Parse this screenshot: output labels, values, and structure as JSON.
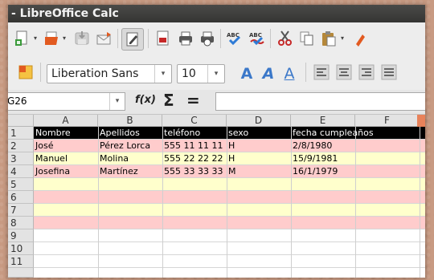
{
  "window": {
    "title": "- LibreOffice Calc"
  },
  "toolbar_standard": {
    "icons": [
      "new-icon",
      "open-icon",
      "save-icon",
      "email-icon",
      "edit-file-icon",
      "export-pdf-icon",
      "print-icon",
      "print-preview-icon",
      "spellcheck-icon",
      "autospellcheck-icon",
      "cut-icon",
      "copy-icon",
      "paste-icon"
    ]
  },
  "toolbar_formatting": {
    "font_name": "Liberation Sans",
    "font_size": "10",
    "bold_label": "A",
    "italic_label": "A",
    "underline_label": "A"
  },
  "formula_bar": {
    "cell_reference": "G26",
    "function_wizard_label": "f(x)",
    "sum_label": "Σ",
    "equals_label": "="
  },
  "sheet": {
    "columns": [
      "A",
      "B",
      "C",
      "D",
      "E",
      "F"
    ],
    "rows": [
      "1",
      "2",
      "3",
      "4",
      "5",
      "6",
      "7",
      "8",
      "9",
      "10",
      "11"
    ],
    "row_colors": [
      "#000000",
      "#ffcccc",
      "#ffffcc",
      "#ffcccc",
      "#ffffcc",
      "#ffcccc",
      "#ffffcc",
      "#ffcccc",
      "#ffffff",
      "#ffffff",
      "#ffffff"
    ],
    "header": [
      "Nombre",
      "Apellidos",
      "teléfono",
      "sexo",
      "fecha cumpleaños"
    ],
    "data": [
      [
        "José",
        "Pérez Lorca",
        "555 11 11 11",
        "H",
        "2/8/1980"
      ],
      [
        "Manuel",
        "Molina",
        "555 22 22 22",
        "H",
        "15/9/1981"
      ],
      [
        "Josefina",
        "Martínez",
        "555 33 33 33",
        "M",
        "16/1/1979"
      ]
    ]
  }
}
